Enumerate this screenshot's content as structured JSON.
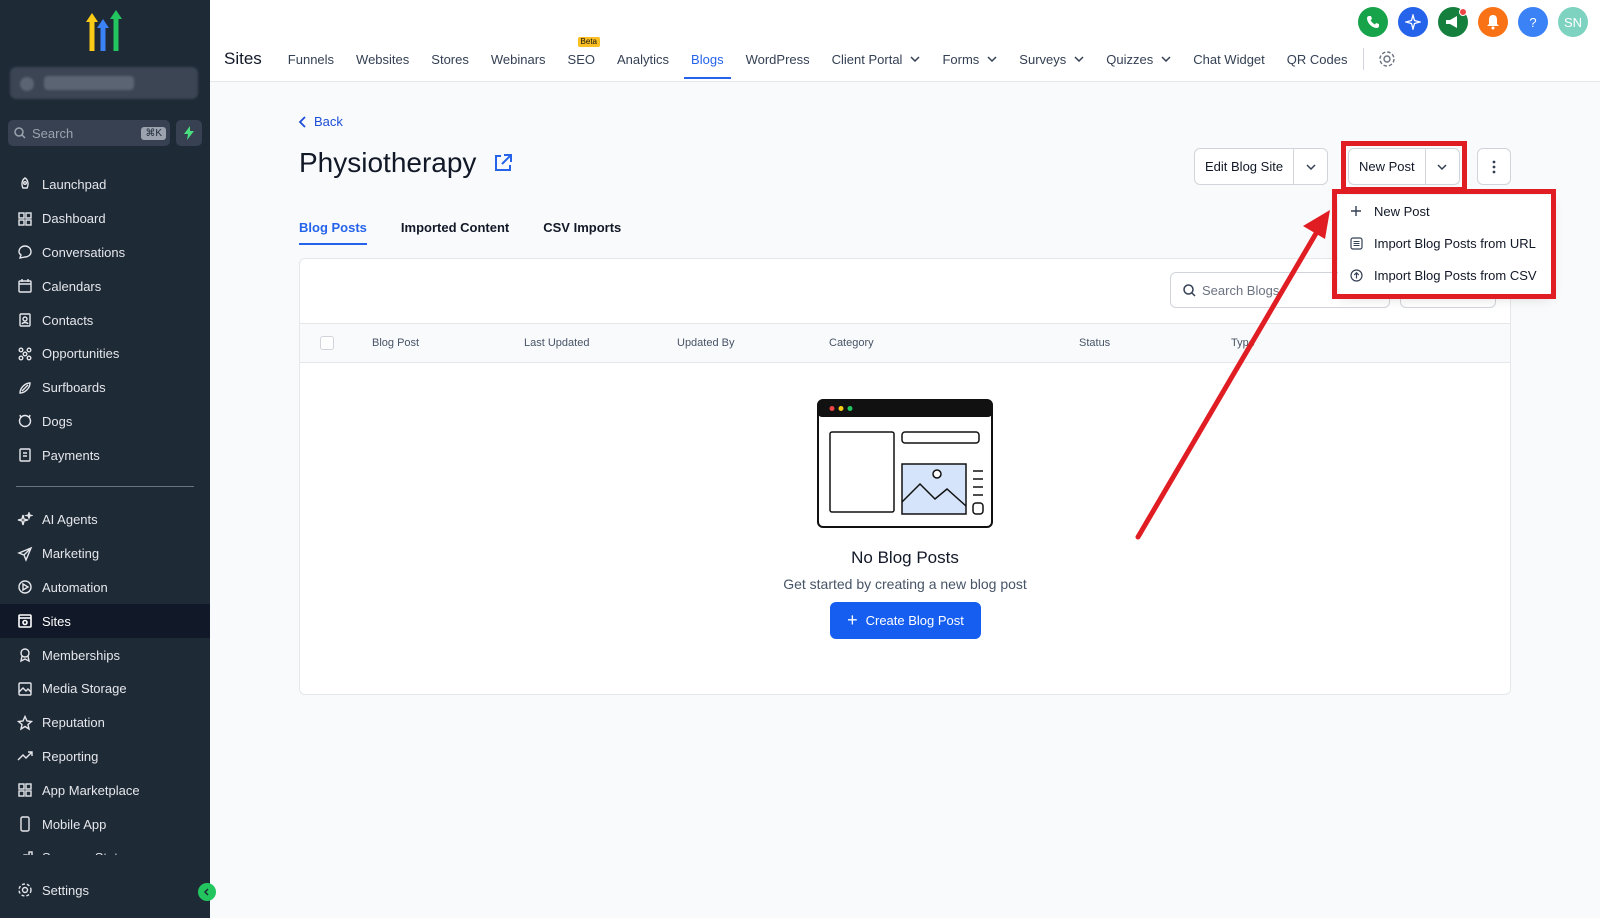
{
  "sidebar": {
    "search_placeholder": "Search",
    "search_shortcut": "⌘K",
    "items": [
      {
        "label": "Launchpad",
        "icon": "rocket-icon"
      },
      {
        "label": "Dashboard",
        "icon": "grid-icon"
      },
      {
        "label": "Conversations",
        "icon": "chat-icon"
      },
      {
        "label": "Calendars",
        "icon": "calendar-icon"
      },
      {
        "label": "Contacts",
        "icon": "contacts-icon"
      },
      {
        "label": "Opportunities",
        "icon": "opportunities-icon"
      },
      {
        "label": "Surfboards",
        "icon": "surfboard-icon"
      },
      {
        "label": "Dogs",
        "icon": "dog-icon"
      },
      {
        "label": "Payments",
        "icon": "payments-icon"
      }
    ],
    "items2": [
      {
        "label": "AI Agents",
        "icon": "sparkle-icon"
      },
      {
        "label": "Marketing",
        "icon": "send-icon"
      },
      {
        "label": "Automation",
        "icon": "automation-icon"
      },
      {
        "label": "Sites",
        "icon": "sites-icon",
        "active": true
      },
      {
        "label": "Memberships",
        "icon": "membership-icon"
      },
      {
        "label": "Media Storage",
        "icon": "image-icon"
      },
      {
        "label": "Reputation",
        "icon": "star-icon"
      },
      {
        "label": "Reporting",
        "icon": "trend-icon"
      },
      {
        "label": "App Marketplace",
        "icon": "apps-icon"
      },
      {
        "label": "Mobile App",
        "icon": "phone-device-icon"
      },
      {
        "label": "Success Stats",
        "icon": "stats-icon"
      }
    ],
    "settings_label": "Settings"
  },
  "topbar": {
    "section": "Sites",
    "beta_label": "Beta",
    "tabs": [
      "Funnels",
      "Websites",
      "Stores",
      "Webinars",
      "SEO",
      "Analytics",
      "Blogs",
      "WordPress",
      "Client Portal",
      "Forms",
      "Surveys",
      "Quizzes",
      "Chat Widget",
      "QR Codes"
    ],
    "avatar_initials": "SN",
    "help_label": "?",
    "colors": {
      "phone": "#16a34a",
      "ai": "#2563eb",
      "announce": "#15803d",
      "bell": "#f97316",
      "help": "#3b82f6",
      "avatar": "#7dd3c0"
    }
  },
  "page": {
    "back_label": "Back",
    "title": "Physiotherapy",
    "edit_label": "Edit Blog Site",
    "new_post_label": "New Post",
    "subtabs": [
      "Blog Posts",
      "Imported Content",
      "CSV Imports"
    ],
    "search_placeholder": "Search Blogs",
    "columns": [
      "Blog Post",
      "Last Updated",
      "Updated By",
      "Category",
      "Status",
      "Type"
    ],
    "empty_title": "No Blog Posts",
    "empty_subtitle": "Get started by creating a new blog post",
    "create_label": "Create Blog Post"
  },
  "menu": {
    "items": [
      {
        "label": "New Post",
        "icon": "plus-icon"
      },
      {
        "label": "Import Blog Posts from URL",
        "icon": "list-icon"
      },
      {
        "label": "Import Blog Posts from CSV",
        "icon": "upload-icon"
      }
    ]
  },
  "annotation_color": "#e11d24",
  "accent": "#155eef"
}
